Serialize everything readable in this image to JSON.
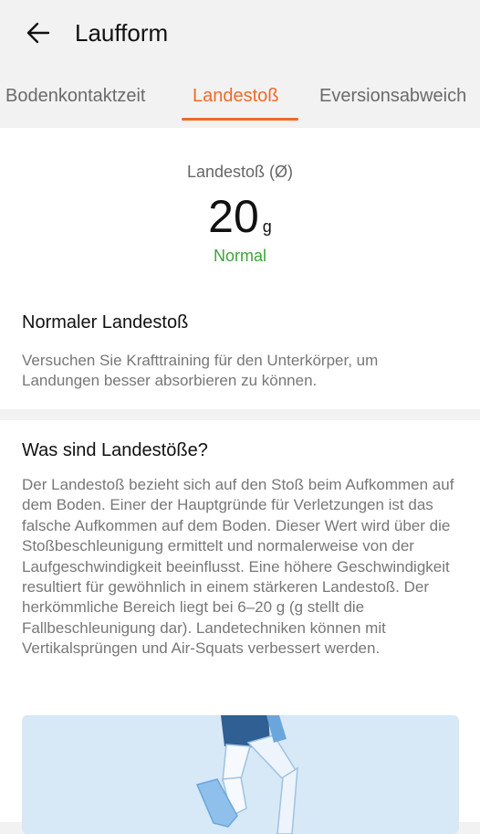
{
  "header": {
    "title": "Laufform",
    "back_icon": "arrow-left-icon"
  },
  "tabs": [
    {
      "label": "Bodenkontaktzeit",
      "active": false
    },
    {
      "label": "Landestoß",
      "active": true
    },
    {
      "label": "Eversionsabweich",
      "active": false
    }
  ],
  "metric": {
    "label": "Landestoß (Ø)",
    "value": "20",
    "unit": "g",
    "status": "Normal"
  },
  "assessment": {
    "title": "Normaler Landestoß",
    "text": "Versuchen Sie Krafttraining für den Unterkörper, um Landungen besser absorbieren zu können."
  },
  "info": {
    "title": "Was sind Landestöße?",
    "text": "Der Landestoß bezieht sich auf den Stoß beim Aufkommen auf dem Boden. Einer der Hauptgründe für Verletzungen ist das falsche Aufkommen auf dem Boden. Dieser Wert wird über die Stoßbeschleunigung ermittelt und normalerweise von der Laufgeschwindigkeit beeinflusst. Eine höhere Geschwindigkeit resultiert für gewöhnlich in einem stärkeren Landestoß. Der herkömmliche Bereich liegt bei 6–20 g (g stellt die Fallbeschleunigung dar). Landetechniken können mit Vertikalsprüngen und Air-Squats verbessert werden."
  },
  "colors": {
    "accent": "#f06a2a",
    "status_normal": "#3fa33a",
    "illustration_bg": "#d7e8f6"
  }
}
